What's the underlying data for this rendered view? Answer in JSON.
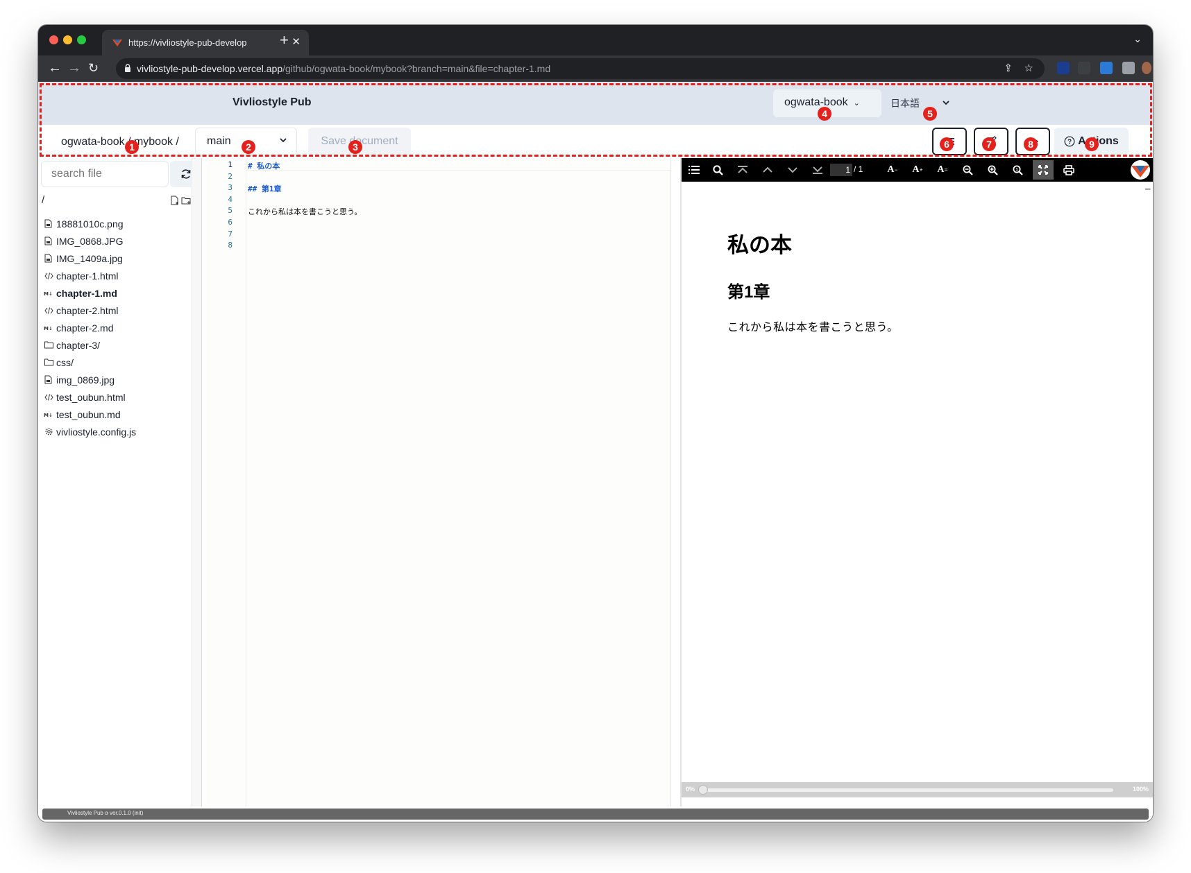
{
  "browser": {
    "tab_title": "https://vivliostyle-pub-develop",
    "url_host": "vivliostyle-pub-develop.vercel.app",
    "url_path": "/github/ogwata-book/mybook?branch=main&file=chapter-1.md"
  },
  "app": {
    "title": "Vivliostyle Pub",
    "account": "ogwata-book",
    "language": "日本語",
    "repo_path": "ogwata-book / mybook /",
    "branch": "main",
    "save_label": "Save document",
    "actions_label": "Actions",
    "markers": [
      "1",
      "2",
      "3",
      "4",
      "5",
      "6",
      "7",
      "8",
      "9"
    ]
  },
  "sidebar": {
    "search_placeholder": "search file",
    "root": "/",
    "files": [
      {
        "name": "18881010c.png",
        "icon": "image-file-icon"
      },
      {
        "name": "IMG_0868.JPG",
        "icon": "image-file-icon"
      },
      {
        "name": "IMG_1409a.jpg",
        "icon": "image-file-icon"
      },
      {
        "name": "chapter-1.html",
        "icon": "code-file-icon"
      },
      {
        "name": "chapter-1.md",
        "icon": "markdown-file-icon",
        "active": true
      },
      {
        "name": "chapter-2.html",
        "icon": "code-file-icon"
      },
      {
        "name": "chapter-2.md",
        "icon": "markdown-file-icon"
      },
      {
        "name": "chapter-3/",
        "icon": "folder-icon"
      },
      {
        "name": "css/",
        "icon": "folder-icon"
      },
      {
        "name": "img_0869.jpg",
        "icon": "image-file-icon"
      },
      {
        "name": "test_oubun.html",
        "icon": "code-file-icon"
      },
      {
        "name": "test_oubun.md",
        "icon": "markdown-file-icon"
      },
      {
        "name": "vivliostyle.config.js",
        "icon": "gear-icon"
      }
    ]
  },
  "editor": {
    "line_numbers": [
      "1",
      "2",
      "3",
      "4",
      "5",
      "6",
      "7",
      "8"
    ],
    "lines": [
      "# 私の本",
      "",
      "## 第1章",
      "",
      "これから私は本を書こうと思う。",
      "",
      "",
      ""
    ]
  },
  "viewer": {
    "page_current": "1",
    "page_total": "/ 1",
    "doc_h1": "私の本",
    "doc_h2": "第1章",
    "doc_p": "これから私は本を書こうと思う。",
    "progress_min": "0%",
    "progress_max": "100%",
    "progress": 0
  },
  "status": {
    "version": "Vivliostyle Pub α ver.0.1.0 (init)"
  },
  "colors": {
    "header_bg": "#dde4ee",
    "marker_red": "#e3211d",
    "heading_blue": "#1a5bd0"
  }
}
